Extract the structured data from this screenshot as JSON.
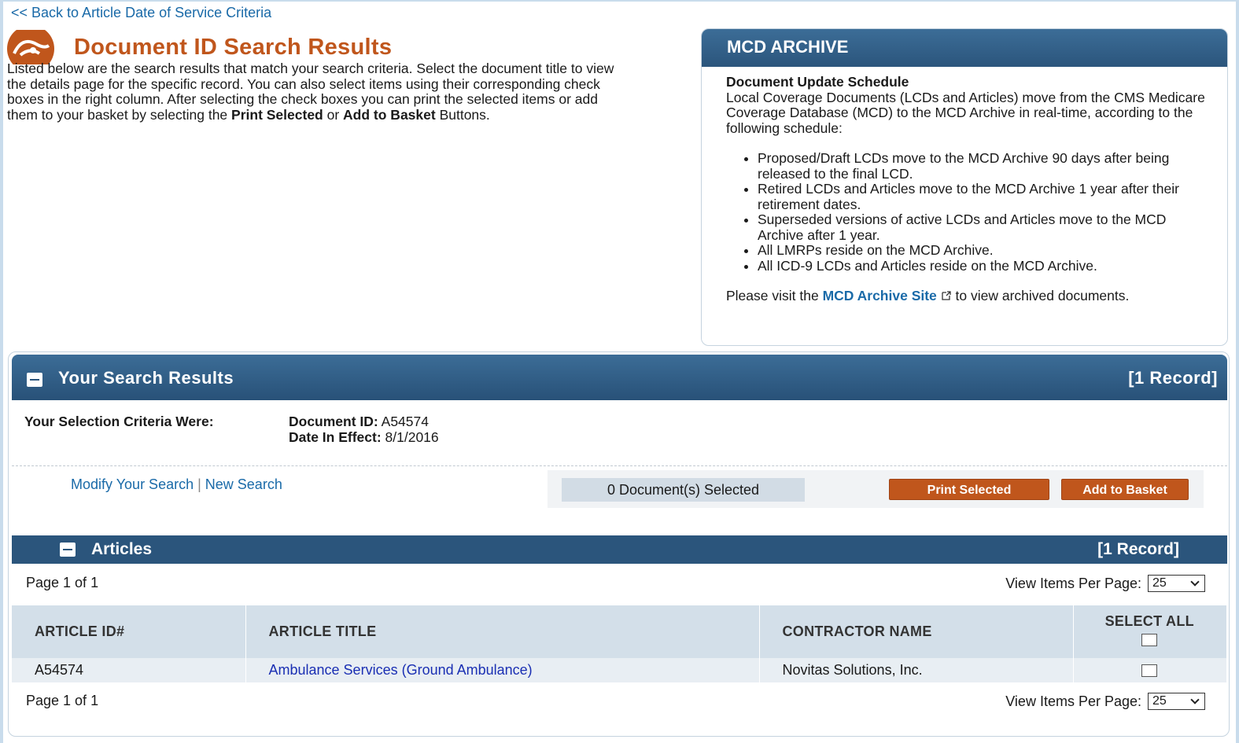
{
  "back_link": "<< Back to Article Date of Service Criteria",
  "page_title": "Document ID Search Results",
  "intro": {
    "part1": "Listed below are the search results that match your search criteria. Select the document title to view the details page for the specific record. You can also select items using their corresponding check boxes in the right column. After selecting the check boxes you can print the selected items or add them to your basket by selecting the ",
    "bold1": "Print Selected",
    "part2": " or ",
    "bold2": "Add to Basket",
    "part3": " Buttons."
  },
  "mcd": {
    "header": "MCD ARCHIVE",
    "schedule_title": "Document Update Schedule",
    "schedule_text": "Local Coverage Documents (LCDs and Articles) move from the CMS Medicare Coverage Database (MCD) to the MCD Archive in real-time, according to the following schedule:",
    "bullets": [
      "Proposed/Draft LCDs move to the MCD Archive 90 days after being released to the final LCD.",
      "Retired LCDs and Articles move to the MCD Archive 1 year after their retirement dates.",
      "Superseded versions of active LCDs and Articles move to the MCD Archive after 1 year.",
      "All LMRPs reside on the MCD Archive.",
      "All ICD-9 LCDs and Articles reside on the MCD Archive."
    ],
    "visit_prefix": "Please visit the ",
    "visit_link": "MCD Archive Site",
    "visit_suffix": " to view archived documents."
  },
  "results": {
    "title": "Your Search Results",
    "count": "[1 Record]",
    "criteria_label": "Your Selection Criteria Were:",
    "doc_id_label": "Document ID:",
    "doc_id_value": " A54574",
    "date_label": "Date In Effect:",
    "date_value": " 8/1/2016",
    "modify_link": "Modify Your Search",
    "link_sep": "|",
    "new_link": "New Search",
    "selected_count": "0 Document(s) Selected",
    "print_button": "Print Selected",
    "basket_button": "Add to Basket"
  },
  "articles": {
    "title": "Articles",
    "count": "[1 Record]",
    "page_info_top": "Page 1 of 1",
    "page_info_bottom": "Page 1 of 1",
    "per_page_label": "View Items Per Page:",
    "per_page_value": "25",
    "columns": [
      "ARTICLE ID#",
      "ARTICLE TITLE",
      "CONTRACTOR NAME",
      "SELECT ALL"
    ],
    "rows": [
      {
        "id": "A54574",
        "title": "Ambulance Services (Ground Ambulance)",
        "contractor": "Novitas Solutions, Inc."
      }
    ]
  },
  "colors": {
    "accent_orange": "#c0561c",
    "header_blue": "#2b557c",
    "link_blue": "#1a6aa8"
  }
}
